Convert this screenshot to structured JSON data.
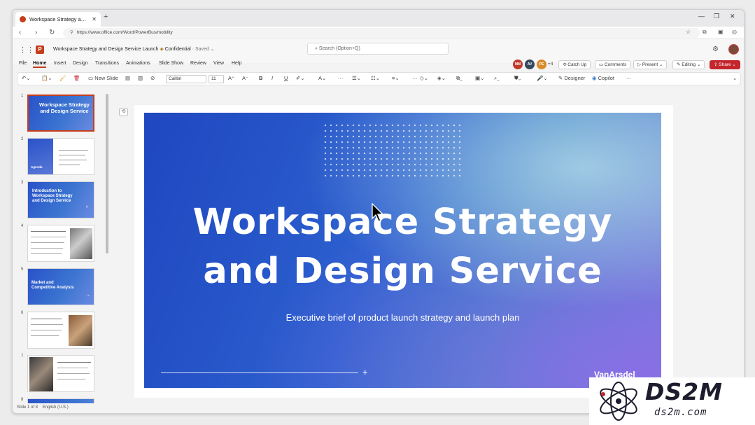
{
  "browser": {
    "tab_title": "Workspace Strategy and Ds...",
    "new_tab": "+",
    "url": "https://www.office.com/Word/PowerBus/mobility",
    "window_controls": [
      "—",
      "❐",
      "✕"
    ]
  },
  "app": {
    "doc_title": "Workspace Strategy and Design Service Launch",
    "sensitivity": "Confidential",
    "save_state": "· Saved",
    "search_placeholder": "Search (Option+Q)",
    "menu": [
      "File",
      "Home",
      "Insert",
      "Design",
      "Transitions",
      "Animations",
      "Slide Show",
      "Review",
      "View",
      "Help"
    ],
    "active_menu": "Home",
    "collab": {
      "avatars": [
        "MM",
        "AV",
        "PE"
      ],
      "extra_count": "+4",
      "catch_up": "Catch Up",
      "comments": "Comments",
      "present": "Present",
      "editing": "Editing",
      "share": "Share"
    }
  },
  "ribbon": {
    "new_slide": "New Slide",
    "font_name": "Calibri",
    "font_size": "11",
    "designer": "Designer",
    "copilot": "Copilot",
    "more": "···"
  },
  "slides_panel": {
    "numbers": [
      "1",
      "2",
      "3",
      "4",
      "5",
      "6",
      "7",
      "8"
    ],
    "thumb1_title": "Workspace Strategy and Design Service",
    "thumb2_label": "Agenda",
    "thumb3_title": "Introduction to Workspace Strategy and Design Service",
    "thumb5_title": "Market and Competitive Analysis"
  },
  "slide": {
    "title_line1": "Workspace Strategy",
    "title_line2": "and Design Service",
    "subtitle": "Executive brief of product launch strategy and launch plan",
    "plus": "+",
    "brand": "VanArsdel"
  },
  "status_bar": {
    "slide_info": "Slide 1 of 8",
    "language": "English (U.S.)"
  },
  "watermark": {
    "title": "DS2M",
    "subtitle": "ds2m.com"
  },
  "colors": {
    "accent": "#c43e1c",
    "share": "#c4262e",
    "slide_blue": "#2c60cf"
  }
}
